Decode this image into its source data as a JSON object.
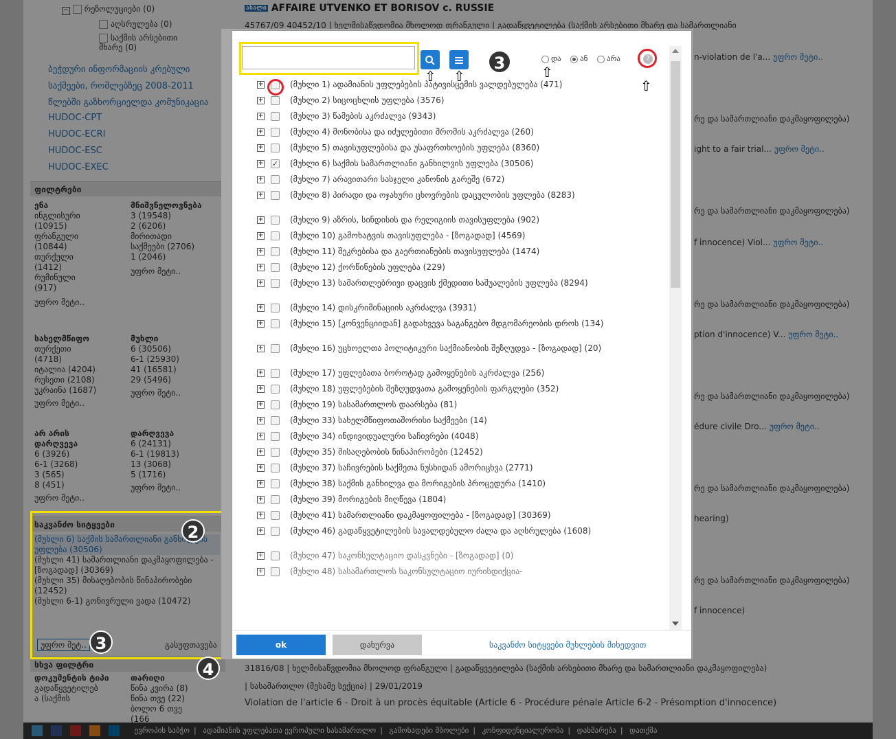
{
  "sidebar": {
    "tree_items": [
      "რეზოლუციები (0)",
      "აღსრულება (0)",
      "საქმის არსებითი მხარე (0)"
    ],
    "links": [
      "ბეჭდური ინფორმაციის კრებული",
      "საქმეები, რომლებზეც 2008-2011",
      "წლებში გაზხორციელდა კომუნიკაცია",
      "HUDOC-CPT",
      "HUDOC-ECRI",
      "HUDOC-ESC",
      "HUDOC-EXEC"
    ],
    "filters_title": "ფილტრები",
    "language": {
      "title": "ენა",
      "items": [
        "ინგლისური",
        "(10915)",
        "ფრანგული",
        "(10844)",
        "თურქული",
        "(1412)",
        "რუმინული",
        "(917)"
      ],
      "more": "უფრო მეტი.."
    },
    "importance": {
      "title": "მნიშვნელოვნება",
      "items": [
        "3 (19548)",
        "2 (6206)",
        "მირითადი",
        "საქმეები (2706)",
        "1 (2046)"
      ],
      "more": "უფრო მეტი.."
    },
    "state": {
      "title": "სახელმწიფო",
      "items": [
        "თურქეთი",
        "(4718)",
        "იტალია (4204)",
        "რუსეთი (2108)",
        "უკრაინა (1687)"
      ],
      "more": "უფრო მეტი.."
    },
    "article": {
      "title": "მუხლი",
      "items": [
        "6 (30506)",
        "6-1 (25930)",
        "41 (16581)",
        "29 (5496)"
      ],
      "more": "უფრო მეტი.."
    },
    "no_violation": {
      "title": "არ არის დარღვევა",
      "items": [
        "6 (3926)",
        "6-1 (3268)",
        "3 (565)",
        "8 (451)"
      ],
      "more": "უფრო მეტი.."
    },
    "violation": {
      "title": "დარღვევა",
      "items": [
        "6 (24131)",
        "6-1 (19813)",
        "13 (3068)",
        "5 (1716)"
      ],
      "more": "უფრო მეტი.."
    },
    "keywords": {
      "title": "საკვანძო სიტყვები",
      "items": [
        "(მუხლი 6) საქმის სამართლიანი განხილვის უფლება (30506)",
        "(მუხლი 41) სამართლიანი დაკმაყოფილება - [ზოგადად] (30369)",
        "(მუხლი 35) მისაღებობის წინაპირობები (12452)",
        "(მუხლი 6-1) გონივრული ვადა (10472)"
      ],
      "more": "უფრო მეტ..",
      "clear": "გასუფთავება"
    },
    "other_filters": "სხვა ფილტრი",
    "doc_type": {
      "title": "დოკუმენტის ტიპი",
      "items": [
        "გადაწყვეტილებ",
        "ა (საქმის"
      ]
    },
    "date": {
      "title": "თარიღი",
      "items": [
        "წინა კვირა (8)",
        "წინა თვე (22)",
        "ბოლო 6 თვე"
      ],
      "extra": "(166"
    }
  },
  "badges": {
    "b2": "2",
    "b3a": "3",
    "b3b": "3",
    "b4": "4"
  },
  "main": {
    "title_prefix": "ახალი",
    "title": "AFFAIRE UTVENKO ET BORISOV c. RUSSIE",
    "line1": "45767/09 40452/10  |  ხელმისაწვდომია მხოლოდ ფრანგული  |  გადაწყვეტილება (საქმის არსებითი მხარე და სამართლიანი",
    "line_bottom1": "31816/08  |  ხელმისაწვდომია მხოლოდ ფრანგული  |  გადაწყვეტილება (საქმის არსებითი მხარე და სამართლიანი დაკმაყოფილება)",
    "line_bottom2": "|  სასამართლო (მესამე სექცია)  |  29/01/2019",
    "line_bottom3": "Violation de l'article 6 - Droit à un procès équitable (Article 6 - Procédure pénale Article 6-2 - Présomption d'innocence)",
    "right_snippets": [
      {
        "text": "n-violation de l'a...",
        "more": "უფრო მეტი.."
      },
      {
        "text": "რე და სამართლიანი დაკმაყოფილება)",
        "more": ""
      },
      {
        "text": "ight to a fair trial...",
        "more": "უფრო მეტი.."
      },
      {
        "text": "რე და სამართლიანი დაკმაყოფილება)",
        "more": ""
      },
      {
        "text": "f innocence) Viol...",
        "more": "უფრო მეტი.."
      },
      {
        "text": "რე და სამართლიანი დაკმაყოფილება)",
        "more": ""
      },
      {
        "text": "ption d'innocence) V...",
        "more": "უფრო მეტი.."
      },
      {
        "text": "რე და სამართლიანი დაკმაყოფილება)",
        "more": ""
      },
      {
        "text": "édure civile Dro...",
        "more": "უფრო მეტი.."
      },
      {
        "text": "რე და სამართლიანი დაკმაყოფილება)",
        "more": ""
      },
      {
        "text": "hearing)",
        "more": ""
      },
      {
        "text": "რე და სამართლიანი დაკმაყოფილება)",
        "more": ""
      },
      {
        "text": "f innocence)",
        "more": ""
      }
    ]
  },
  "footer": {
    "links": [
      "ევროპის საბჭო",
      "ადამიანის უფლებათა ევროპული სასამართლო",
      "გამოხადები მბოლები",
      "კონფიდენციალურობა",
      "დახმარება",
      "დათქმა"
    ]
  },
  "modal": {
    "search": {
      "value": "",
      "placeholder": ""
    },
    "arrows": [
      "⇧",
      "⇧",
      "⇧",
      "⇧"
    ],
    "radios": [
      {
        "label": "და",
        "on": false
      },
      {
        "label": "ან",
        "on": true
      },
      {
        "label": "არა",
        "on": false
      }
    ],
    "help": "?",
    "items": [
      {
        "label": "(მუხლი 1) ადამიანის უფლებების პატივისცემის ვალდებულება (471)",
        "checked": false
      },
      {
        "label": "(მუხლი 2) სიცოცხლის უფლება (3576)",
        "checked": false
      },
      {
        "label": "(მუხლი 3) წამების აკრძალვა (9343)",
        "checked": false
      },
      {
        "label": "(მუხლი 4) მონობისა და იძულებითი შრომის აკრძალვა (260)",
        "checked": false
      },
      {
        "label": "(მუხლი 5) თავისუფლებისა და უსაფრთხოების უფლება (8360)",
        "checked": false
      },
      {
        "label": "(მუხლი 6) საქმის სამართლიანი განხილვის უფლება (30506)",
        "checked": true
      },
      {
        "label": "(მუხლი 7) არავითარი სასჯელი კანონის გარეშე (672)",
        "checked": false
      },
      {
        "label": "(მუხლი 8) პირადი და ოჯახური ცხოვრების დაცულობის უფლება (8283)",
        "checked": false
      },
      {
        "label": "(მუხლი 9) აზრის, სინდისის და რელიგიის თავისუფლება (902)",
        "checked": false
      },
      {
        "label": "(მუხლი 10) გამოხატვის თავისუფლება - [ზოგადად] (4569)",
        "checked": false
      },
      {
        "label": "(მუხლი 11) შეკრებისა და გაერთიანების თავისუფლება (1474)",
        "checked": false
      },
      {
        "label": "(მუხლი 12) ქორწინების უფლება (229)",
        "checked": false
      },
      {
        "label": "(მუხლი 13) სამართლებრივი დაცვის ქმედითი საშუალების უფლება (8294)",
        "checked": false
      },
      {
        "label": "(მუხლი 14) დისკრიმინაციის აკრძალვა (3931)",
        "checked": false
      },
      {
        "label": "(მუხლი 15) [კონვენციიდან] გადახვევა საგანგებო მდგომარეობის დროს (134)",
        "checked": false
      },
      {
        "label": "(მუხლი 16) უცხოელთა პოლიტიკური საქმიანობის შეზღუდვა - [ზოგადად] (20)",
        "checked": false
      },
      {
        "label": "(მუხლი 17) უფლებათა ბოროტად გამოყენების აკრძალვა (256)",
        "checked": false
      },
      {
        "label": "(მუხლი 18) უფლებების შეზღუდვათა გამოყენების ფარგლები (352)",
        "checked": false
      },
      {
        "label": "(მუხლი 19) სასამართლოს დაარსება (81)",
        "checked": false
      },
      {
        "label": "(მუხლი 33) სახელმწიფოთაშორისი საქმეები (14)",
        "checked": false
      },
      {
        "label": "(მუხლი 34) ინდივიდუალური საჩივრები (4048)",
        "checked": false
      },
      {
        "label": "(მუხლი 35) მისაღებობის წინაპირობები (12452)",
        "checked": false
      },
      {
        "label": "(მუხლი 37) საჩივრების საქმეთა ნუსხიდან ამორიცხვა (2771)",
        "checked": false
      },
      {
        "label": "(მუხლი 38) საქმის განხილვა და მორიგების პროცედურა (1410)",
        "checked": false
      },
      {
        "label": "(მუხლი 39) მორიგების მიღწევა (1804)",
        "checked": false
      },
      {
        "label": "(მუხლი 41) სამართლიანი დაკმაყოფილება - [ზოგადად] (30369)",
        "checked": false
      },
      {
        "label": "(მუხლი 46) გადაწყვეტილების სავალდებულო ძალა და აღსრულება (1608)",
        "checked": false
      },
      {
        "label": "(მუხლი 47) საკონსულტაციო დასკვნები - [ზოგადად] (0)",
        "checked": false,
        "dim": true
      },
      {
        "label": "(მუხლი 48) სასამართლოს საკონსულტაციო იურისდიქცია-",
        "checked": false,
        "dim": true
      }
    ],
    "ok": "ok",
    "close": "დახურვა",
    "sort_link": "საკვანძო სიტყვები მუხლების მიხედვით"
  },
  "colors": {
    "accent": "#1f7ad1",
    "highlight": "#f2e100",
    "annotation_red": "#e0202a"
  }
}
